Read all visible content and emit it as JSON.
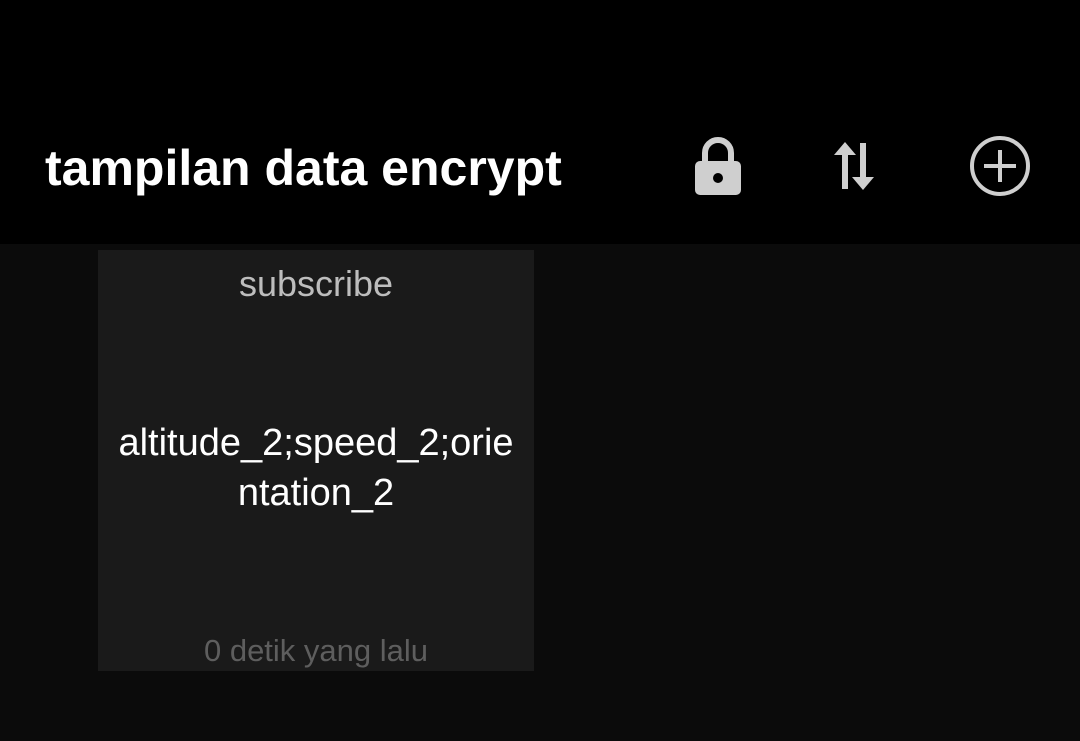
{
  "appbar": {
    "title": "tampilan data encrypt",
    "actions": [
      {
        "icon": "lock-icon"
      },
      {
        "icon": "sort-arrows-icon"
      },
      {
        "icon": "add-circle-icon"
      }
    ]
  },
  "cards": [
    {
      "topic": "subscribe",
      "message": "altitude_2;speed_2;orientation_2",
      "time": "0 detik yang lalu"
    }
  ],
  "colors": {
    "appbar_bg": "#000000",
    "page_bg": "#0b0b0b",
    "card_bg": "#1a1a1a",
    "icon": "#cfcfcf"
  }
}
